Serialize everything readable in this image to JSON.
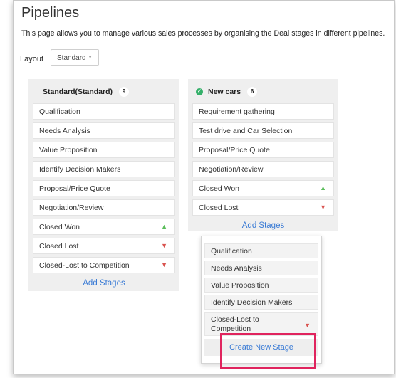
{
  "page": {
    "title": "Pipelines",
    "description": "This page allows you to manage various sales processes by organising the Deal stages in different pipelines."
  },
  "layout": {
    "label": "Layout",
    "selected": "Standard"
  },
  "pipelines": [
    {
      "name": "Standard(Standard)",
      "count": "9",
      "stages": [
        {
          "label": "Qualification",
          "icon": ""
        },
        {
          "label": "Needs Analysis",
          "icon": ""
        },
        {
          "label": "Value Proposition",
          "icon": ""
        },
        {
          "label": "Identify Decision Makers",
          "icon": ""
        },
        {
          "label": "Proposal/Price Quote",
          "icon": ""
        },
        {
          "label": "Negotiation/Review",
          "icon": ""
        },
        {
          "label": "Closed Won",
          "icon": "thumbs-up-icon"
        },
        {
          "label": "Closed Lost",
          "icon": "thumbs-down-icon"
        },
        {
          "label": "Closed-Lost to Competition",
          "icon": "thumbs-down-icon"
        }
      ],
      "add_label": "Add Stages"
    },
    {
      "name": "New cars",
      "count": "6",
      "stages": [
        {
          "label": "Requirement gathering",
          "icon": ""
        },
        {
          "label": "Test drive and Car Selection",
          "icon": ""
        },
        {
          "label": "Proposal/Price Quote",
          "icon": ""
        },
        {
          "label": "Negotiation/Review",
          "icon": ""
        },
        {
          "label": "Closed Won",
          "icon": "thumbs-up-icon"
        },
        {
          "label": "Closed Lost",
          "icon": "thumbs-down-icon"
        }
      ],
      "add_label": "Add Stages"
    }
  ],
  "dropdown": {
    "items": [
      {
        "label": "Qualification"
      },
      {
        "label": "Needs Analysis"
      },
      {
        "label": "Value Proposition"
      },
      {
        "label": "Identify Decision Makers"
      },
      {
        "label": "Closed-Lost to Competition",
        "icon": "thumbs-down-icon"
      }
    ],
    "create_label": "Create New Stage"
  },
  "colors": {
    "accent": "#3a7bd5",
    "highlight": "#e0245e",
    "won": "#5bbd5b",
    "lost": "#d9534f",
    "active_check": "#35b06a"
  }
}
